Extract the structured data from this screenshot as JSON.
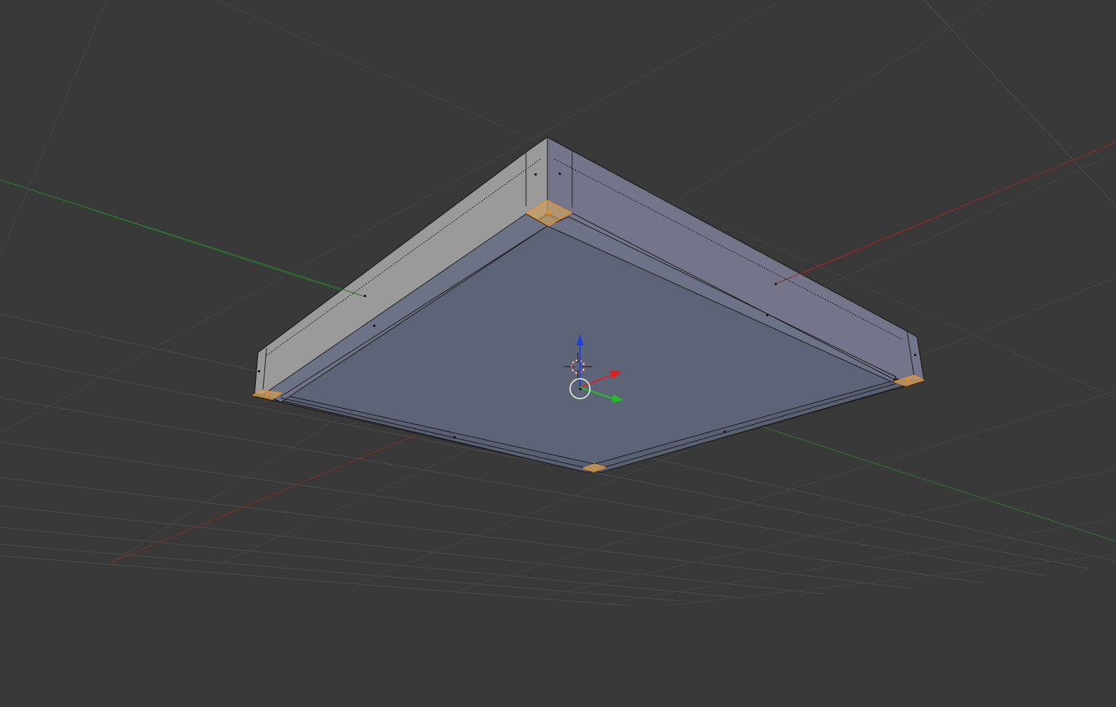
{
  "app": {
    "name": "3D Viewport",
    "mode": "edit-mesh",
    "select_mode": "face"
  },
  "colors": {
    "background": "#393939",
    "grid_line": "#4d4d4d",
    "grid_line_faint": "#444444",
    "axis_x": "#8a2a2a",
    "axis_y": "#2a7a2a",
    "face_bottom": "#5e6477",
    "face_rim_left": "#9a9a9a",
    "face_rim_right": "#74748a",
    "face_rim_front_left": "#5a6074",
    "face_rim_front_right": "#5a6074",
    "face_inner_wall": "#6e7286",
    "edge": "#1a1a1a",
    "selected_face": "#c8a066",
    "selected_edge": "#f08a1e",
    "selected_dot": "#ff8c00",
    "face_dot": "#111111",
    "gizmo_x": "#e02020",
    "gizmo_y": "#20c020",
    "gizmo_z": "#2040e0",
    "gizmo_center": "#ffffff",
    "cursor_red": "#d03030",
    "cursor_white": "#ffffff"
  },
  "mesh": {
    "selected_faces": 4,
    "face_dots": 10
  },
  "icons": {
    "transform_gizmo": "transform-gizmo-icon",
    "cursor_3d": "3d-cursor-icon"
  }
}
